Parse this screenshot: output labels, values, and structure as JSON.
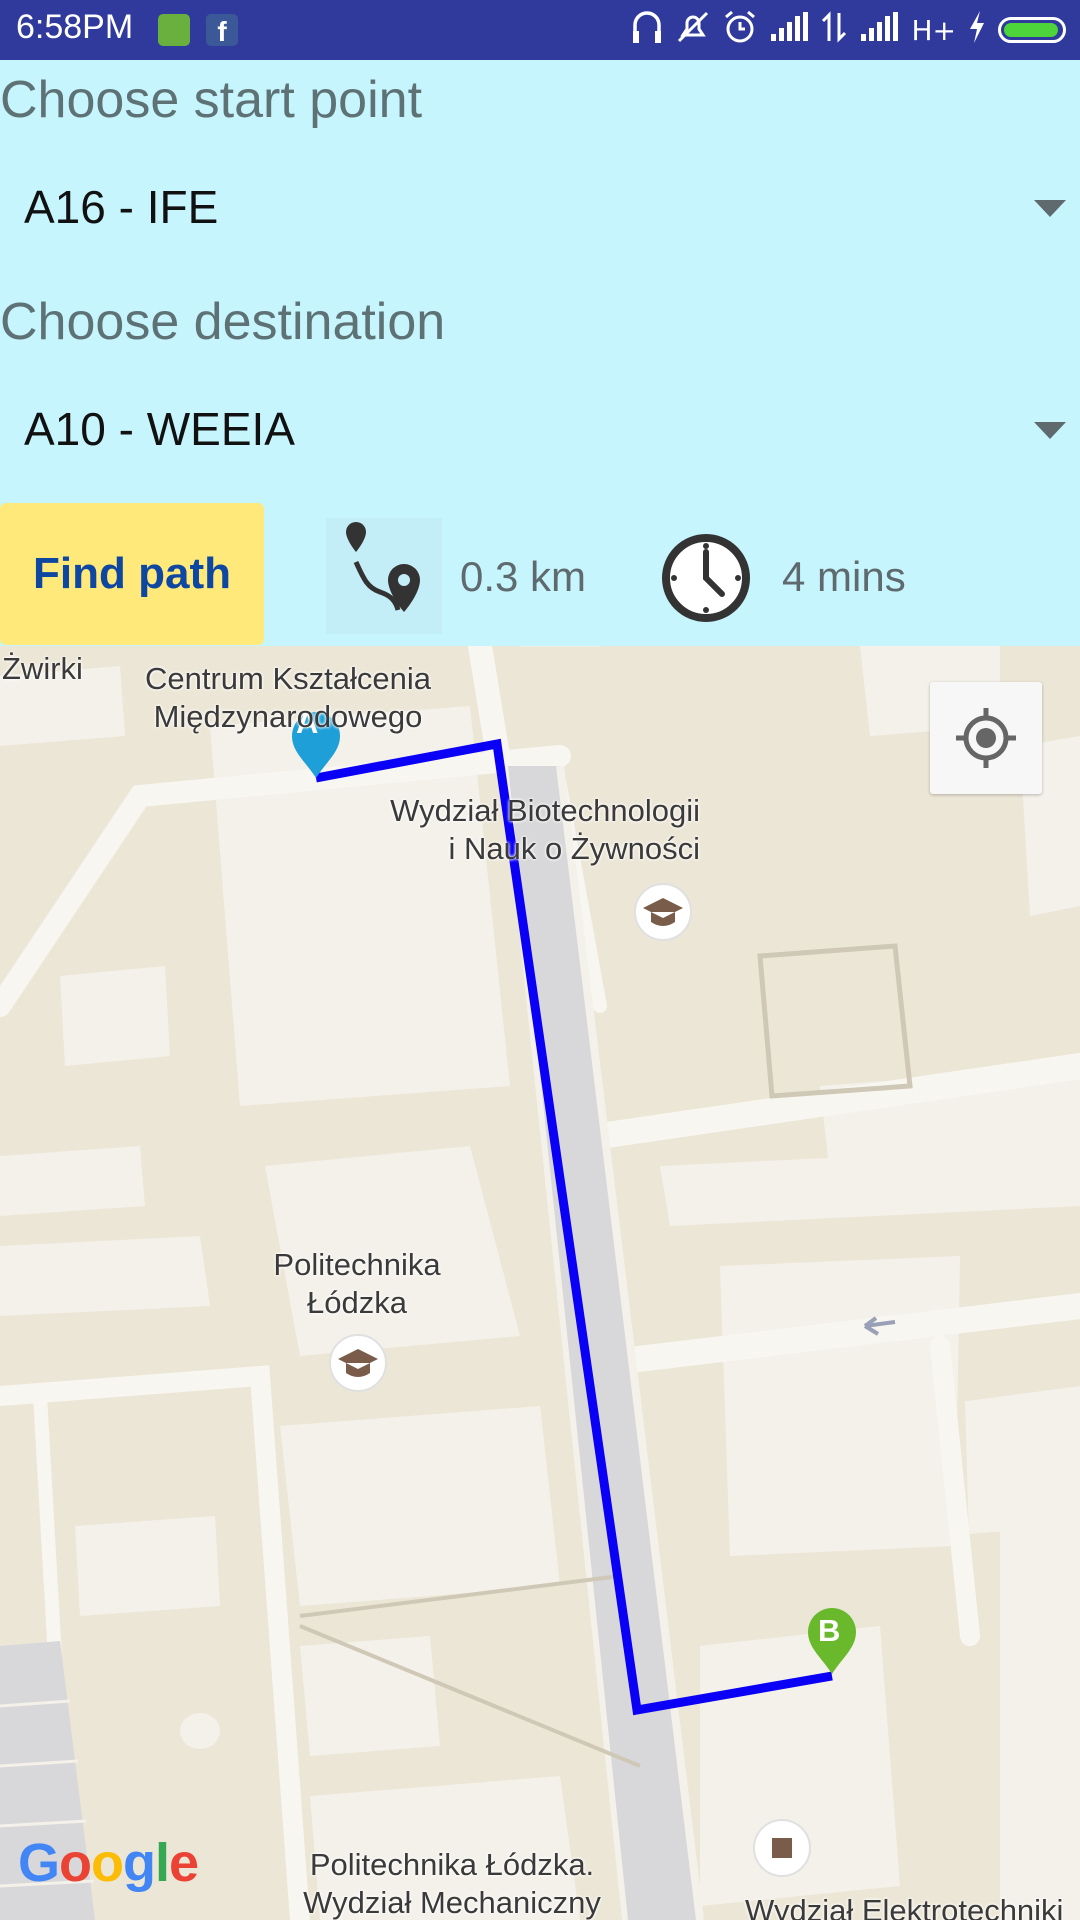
{
  "status_bar": {
    "time": "6:58PM",
    "network": "H+"
  },
  "form": {
    "start_label": "Choose start point",
    "start_value": "A16 - IFE",
    "destination_label": "Choose destination",
    "destination_value": "A10 - WEEIA",
    "find_button": "Find path",
    "distance": "0.3 km",
    "duration": "4 mins"
  },
  "map": {
    "labels": {
      "zwirki": "Żwirki",
      "ckm_line1": "Centrum Kształcenia",
      "ckm_line2": "Międzynarodowego",
      "wbnz_line1": "Wydział Biotechnologii",
      "wbnz_line2": "i Nauk o Żywności",
      "pl_line1": "Politechnika",
      "pl_line2": "Łódzka",
      "wm_line1": "Politechnika Łódzka.",
      "wm_line2": "Wydział Mechaniczny",
      "weeia": "Wydział Elektrotechniki"
    },
    "marker_start": "A",
    "marker_end": "B",
    "route_color": "#0a00f5",
    "attribution": "Google"
  }
}
